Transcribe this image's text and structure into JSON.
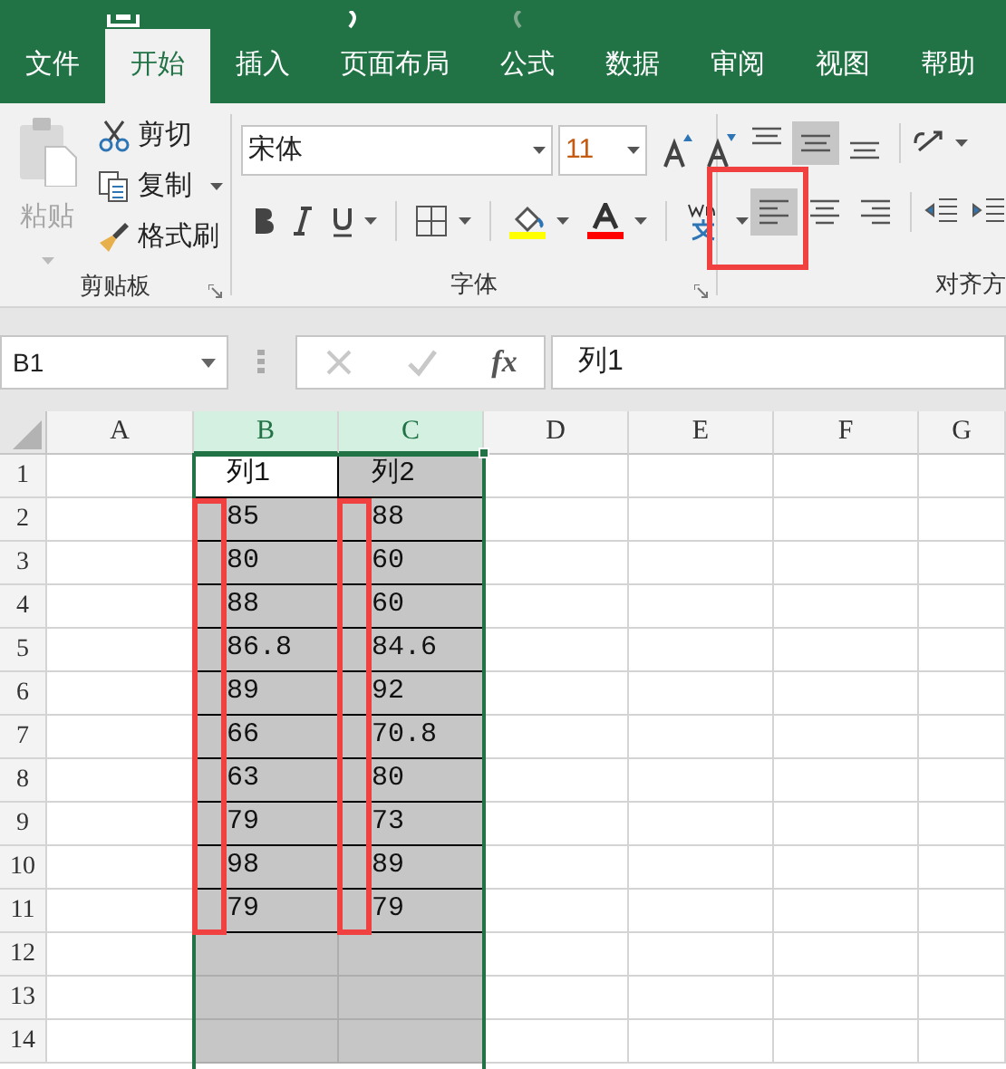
{
  "tabs": [
    {
      "label": "文件",
      "selected": false
    },
    {
      "label": "开始",
      "selected": true
    },
    {
      "label": "插入",
      "selected": false
    },
    {
      "label": "页面布局",
      "selected": false
    },
    {
      "label": "公式",
      "selected": false
    },
    {
      "label": "数据",
      "selected": false
    },
    {
      "label": "审阅",
      "selected": false
    },
    {
      "label": "视图",
      "selected": false
    },
    {
      "label": "帮助",
      "selected": false
    }
  ],
  "ribbon": {
    "clipboard": {
      "paste": "粘贴",
      "paste_disabled": true,
      "cut": "剪切",
      "copy": "复制",
      "format_painter": "格式刷",
      "label": "剪贴板"
    },
    "font": {
      "font_name": "宋体",
      "font_size": "11",
      "label": "字体"
    },
    "alignment": {
      "label": "对齐方",
      "vertical": [
        {
          "kind": "top",
          "selected": false
        },
        {
          "kind": "middle",
          "selected": true
        },
        {
          "kind": "bottom",
          "selected": false
        }
      ],
      "horizontal": [
        {
          "kind": "left",
          "selected": true,
          "highlighted": true
        },
        {
          "kind": "center",
          "selected": false,
          "highlighted": false
        },
        {
          "kind": "right",
          "selected": false,
          "highlighted": false
        }
      ]
    }
  },
  "formula_bar": {
    "name_box": "B1",
    "function_label": "fx",
    "formula": "列1"
  },
  "sheet": {
    "columns": [
      {
        "label": "A",
        "selected": false,
        "marked": false
      },
      {
        "label": "B",
        "selected": true,
        "marked": true,
        "cells": [
          {
            "value": "列1",
            "active": true
          },
          {
            "value": "85",
            "active": false
          },
          {
            "value": "80",
            "active": false
          },
          {
            "value": "88",
            "active": false
          },
          {
            "value": "86.8",
            "active": false
          },
          {
            "value": "89",
            "active": false
          },
          {
            "value": "66",
            "active": false
          },
          {
            "value": "63",
            "active": false
          },
          {
            "value": "79",
            "active": false
          },
          {
            "value": "98",
            "active": false
          },
          {
            "value": "79",
            "active": false
          }
        ]
      },
      {
        "label": "C",
        "selected": true,
        "marked": true,
        "cells": [
          {
            "value": "列2",
            "active": false
          },
          {
            "value": "88",
            "active": false
          },
          {
            "value": "60",
            "active": false
          },
          {
            "value": "60",
            "active": false
          },
          {
            "value": "84.6",
            "active": false
          },
          {
            "value": "92",
            "active": false
          },
          {
            "value": "70.8",
            "active": false
          },
          {
            "value": "80",
            "active": false
          },
          {
            "value": "73",
            "active": false
          },
          {
            "value": "89",
            "active": false
          },
          {
            "value": "79",
            "active": false
          }
        ]
      },
      {
        "label": "D",
        "selected": false,
        "marked": false
      },
      {
        "label": "E",
        "selected": false,
        "marked": false
      },
      {
        "label": "F",
        "selected": false,
        "marked": false
      },
      {
        "label": "G",
        "selected": false,
        "marked": false
      }
    ],
    "rows": [
      {
        "label": "1",
        "bordered": true
      },
      {
        "label": "2",
        "bordered": true
      },
      {
        "label": "3",
        "bordered": true
      },
      {
        "label": "4",
        "bordered": true
      },
      {
        "label": "5",
        "bordered": true
      },
      {
        "label": "6",
        "bordered": true
      },
      {
        "label": "7",
        "bordered": true
      },
      {
        "label": "8",
        "bordered": true
      },
      {
        "label": "9",
        "bordered": true
      },
      {
        "label": "10",
        "bordered": true
      },
      {
        "label": "11",
        "bordered": true
      },
      {
        "label": "12",
        "bordered": false
      },
      {
        "label": "13",
        "bordered": false
      },
      {
        "label": "14",
        "bordered": false
      }
    ]
  }
}
